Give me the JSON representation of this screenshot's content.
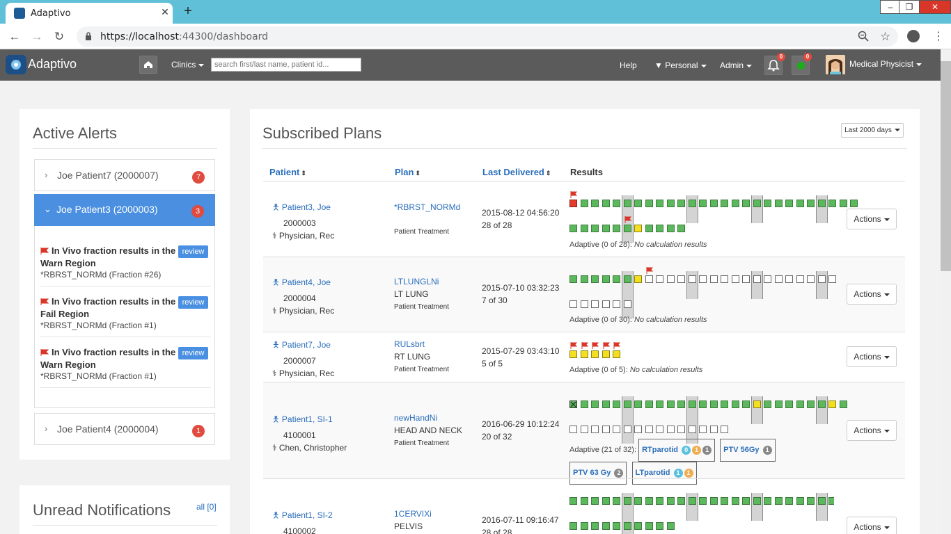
{
  "browser": {
    "tab_title": "Adaptivo",
    "url_host": "https://localhost",
    "url_path": ":44300/dashboard",
    "win_min": "–",
    "win_max": "❐",
    "win_close": "✕",
    "new_tab": "+",
    "tab_close": "✕"
  },
  "navbar": {
    "brand": "Adaptivo",
    "clinics": "Clinics",
    "search_placeholder": "search first/last name, patient id...",
    "help": "Help",
    "personal": "Personal",
    "admin": "Admin",
    "bell_count": "0",
    "status_count": "0",
    "user": "Medical Physicist"
  },
  "alerts": {
    "title": "Active Alerts",
    "groups": [
      {
        "label": "Joe Patient7 (2000007)",
        "count": "7"
      },
      {
        "label": "Joe Patient3 (2000003)",
        "count": "3"
      },
      {
        "label": "Joe Patient4 (2000004)",
        "count": "1"
      }
    ],
    "items": [
      {
        "title1": "In Vivo fraction results in the",
        "title2": "Warn Region",
        "sub": "*RBRST_NORMd (Fraction #26)",
        "button": "review"
      },
      {
        "title1": "In Vivo fraction results in the",
        "title2": "Fail Region",
        "sub": "*RBRST_NORMd (Fraction #1)",
        "button": "review"
      },
      {
        "title1": "In Vivo fraction results in the",
        "title2": "Warn Region",
        "sub": "*RBRST_NORMd (Fraction #1)",
        "button": "review"
      }
    ]
  },
  "notifications": {
    "title": "Unread Notifications",
    "all_link": "all [0]"
  },
  "plans": {
    "title": "Subscribed Plans",
    "range": "Last 2000 days",
    "columns": {
      "patient": "Patient",
      "plan": "Plan",
      "last": "Last Delivered",
      "results": "Results"
    },
    "actions": "Actions",
    "rows": [
      {
        "patient": "Patient3, Joe",
        "id": "2000003",
        "physician": "Physician, Rec",
        "plan": "*RBRST_NORMd",
        "site": "",
        "plan_type": "Patient Treatment",
        "date": "2015-08-12 04:56:20",
        "frac": "28 of 28",
        "adaptive": "Adaptive (0 of 28):",
        "calc": "No calculation results",
        "squares": "rgggggggggggggggggggggggggg|ggggggygggg"
      },
      {
        "patient": "Patient4, Joe",
        "id": "2000004",
        "physician": "Physician, Rec",
        "plan": "LTLUNGLNi",
        "site": "LT LUNG",
        "plan_type": "Patient Treatment",
        "date": "2015-07-10 03:32:23",
        "frac": "7 of 30",
        "adaptive": "Adaptive (0 of 30):",
        "calc": "No calculation results",
        "squares": "ggggggyeeeeeeeeeeeeeeeeee|eeeeee"
      },
      {
        "patient": "Patient7, Joe",
        "id": "2000007",
        "physician": "Physician, Rec",
        "plan": "RULsbrt",
        "site": "RT LUNG",
        "plan_type": "Patient Treatment",
        "date": "2015-07-29 03:43:10",
        "frac": "5 of 5",
        "adaptive": "Adaptive (0 of 5):",
        "calc": "No calculation results",
        "squares": "yyyyy"
      },
      {
        "patient": "Patient1, SI-1",
        "id": "4100001",
        "physician": "Chen, Christopher",
        "plan": "newHandNi",
        "site": "HEAD AND NECK",
        "plan_type": "Patient Treatment",
        "date": "2016-06-29 10:12:24",
        "frac": "20 of 32",
        "adaptive": "Adaptive (21 of 32):",
        "calc": "",
        "squares": "xggggggggggggggggyggggggyg|eeeeeeeeeeeeeee"
      },
      {
        "patient": "Patient1, SI-2",
        "id": "4100002",
        "physician": "",
        "plan": "1CERVIXi",
        "site": "PELVIS",
        "plan_type": "",
        "date": "2016-07-11 09:16:47",
        "frac": "28 of 28",
        "adaptive": "",
        "calc": "",
        "squares": ""
      }
    ],
    "structures": [
      {
        "name": "RTparotid",
        "counts": [
          "0",
          "1",
          "1"
        ]
      },
      {
        "name": "PTV 56Gy",
        "counts": [
          "1"
        ]
      },
      {
        "name": "PTV 63 Gy",
        "counts": [
          "2"
        ]
      },
      {
        "name": "LTparotid",
        "counts": [
          "1",
          "1"
        ]
      }
    ]
  },
  "colors": {
    "accent": "#4a90e2",
    "navbar": "#5b5b5b",
    "green": "#5cb85c",
    "yellow": "#f2df1f",
    "red": "#e33c2d",
    "badge": "#e04a3f"
  }
}
